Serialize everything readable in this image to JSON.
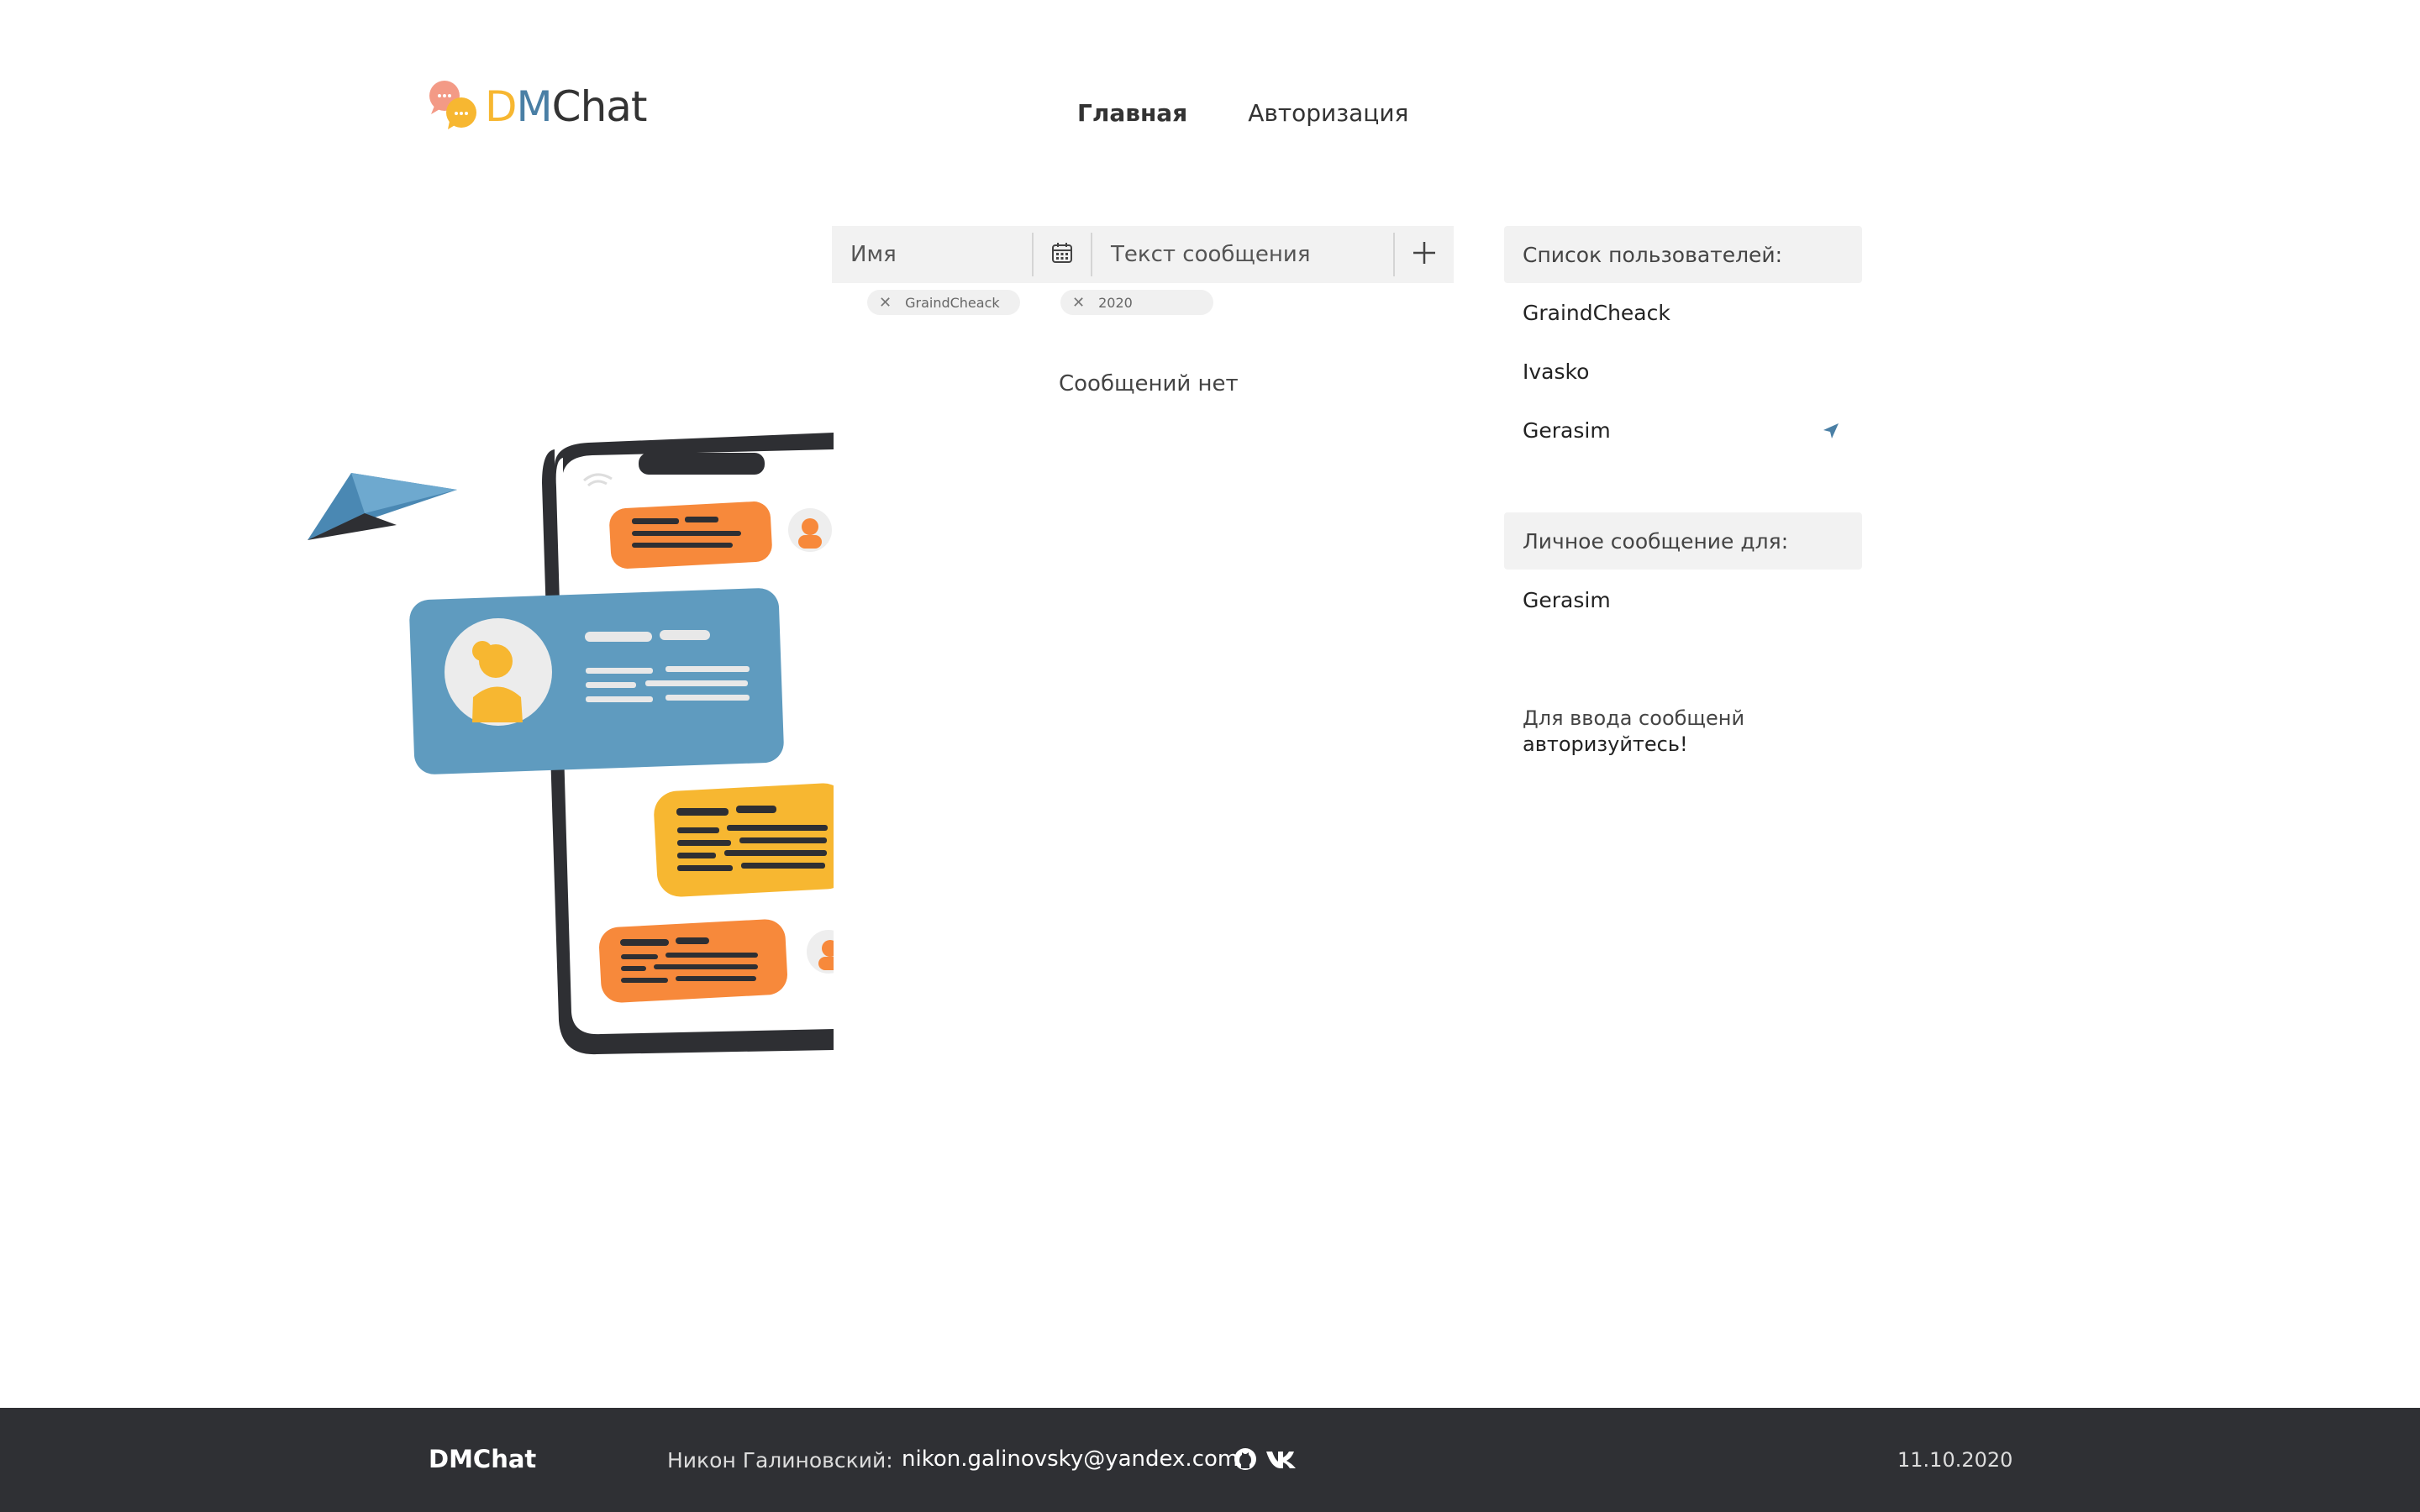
{
  "header": {
    "logo_prefix_d": "D",
    "logo_prefix_m": "M",
    "logo_suffix": "Chat",
    "nav": [
      {
        "label": "Главная",
        "active": true
      },
      {
        "label": "Авторизация",
        "active": false
      }
    ]
  },
  "form": {
    "name_placeholder": "Имя",
    "message_placeholder": "Текст сообщения",
    "date_icon": "calendar-icon",
    "add_icon": "plus-icon"
  },
  "filters": {
    "name_chip": "GraindCheack",
    "date_chip": "2020"
  },
  "messages": {
    "empty_text": "Сообщений нет"
  },
  "sidebar": {
    "users_title": "Список пользователей:",
    "users": [
      "GraindCheack",
      "Ivasko",
      "Gerasim"
    ],
    "selected_user_icon": "send-arrow-icon",
    "pm_title": "Личное сообщение для:",
    "pm_user": "Gerasim",
    "hint_line1": "Для ввода сообщенй",
    "hint_line2": "авторизуйтесь!"
  },
  "footer": {
    "brand": "DMChat",
    "author_label": "Никон Галиновский:",
    "email": "nikon.galinovsky@yandex.com",
    "icons": [
      "github-icon",
      "vk-icon"
    ],
    "date": "11.10.2020"
  },
  "colors": {
    "accent_yellow": "#f7b731",
    "accent_blue": "#4a7fa5",
    "card_blue": "#5f9bbf",
    "orange": "#f7893b",
    "footer_bg": "#2f3034"
  }
}
